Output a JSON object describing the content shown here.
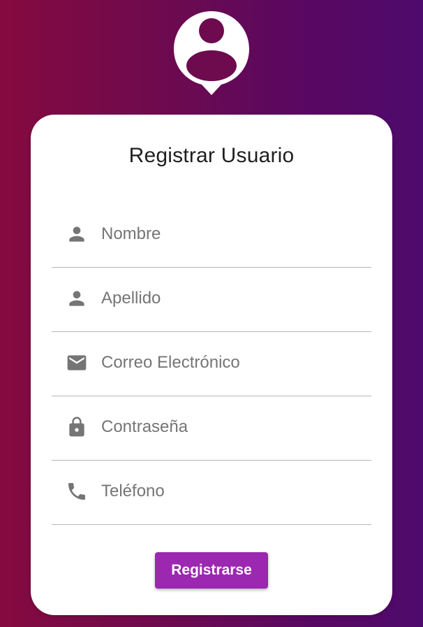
{
  "colors": {
    "gradient_start": "#850a3f",
    "gradient_end": "#4e0a6c",
    "card_background": "#ffffff",
    "accent_button": "#9c27b0",
    "icon_gray": "#757575",
    "avatar_fill": "#6e0a4e"
  },
  "header": {
    "avatar_icon": "user-location-pin-icon"
  },
  "form": {
    "title": "Registrar Usuario",
    "fields": [
      {
        "icon": "person-icon",
        "placeholder": "Nombre",
        "value": ""
      },
      {
        "icon": "person-icon",
        "placeholder": "Apellido",
        "value": ""
      },
      {
        "icon": "email-icon",
        "placeholder": "Correo Electrónico",
        "value": ""
      },
      {
        "icon": "lock-icon",
        "placeholder": "Contraseña",
        "value": ""
      },
      {
        "icon": "phone-icon",
        "placeholder": "Teléfono",
        "value": ""
      }
    ],
    "submit_label": "Registrarse"
  }
}
